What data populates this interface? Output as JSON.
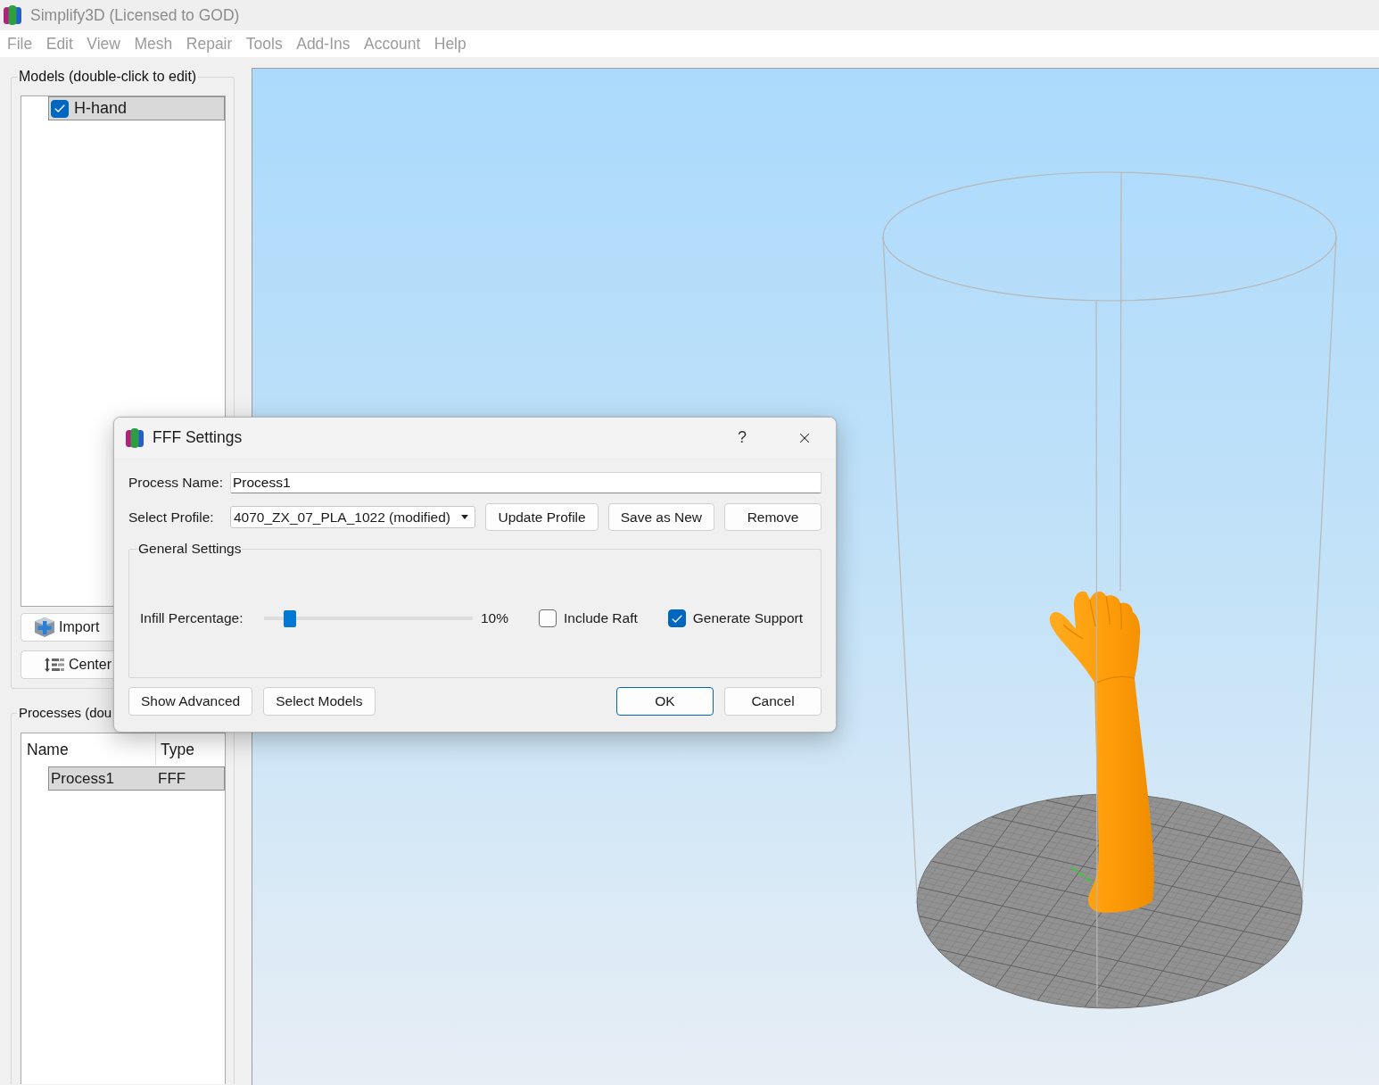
{
  "window": {
    "title": "Simplify3D (Licensed to GOD)"
  },
  "menu": [
    "File",
    "Edit",
    "View",
    "Mesh",
    "Repair",
    "Tools",
    "Add-Ins",
    "Account",
    "Help"
  ],
  "models_panel": {
    "title": "Models (double-click to edit)",
    "items": [
      {
        "name": "H-hand",
        "checked": true,
        "selected": true
      }
    ],
    "buttons": [
      {
        "label": "Import",
        "kind": "import"
      },
      {
        "label": "Center",
        "kind": "center"
      }
    ]
  },
  "processes_panel": {
    "title": "Processes (dou",
    "columns": [
      "Name",
      "Type"
    ],
    "rows": [
      {
        "name": "Process1",
        "type": "FFF",
        "selected": true
      }
    ]
  },
  "dialog": {
    "title": "FFF Settings",
    "help": "?",
    "process_name": {
      "label": "Process Name:",
      "value": "Process1"
    },
    "profile": {
      "label": "Select Profile:",
      "value": "4070_ZX_07_PLA_1022 (modified)",
      "buttons": [
        "Update Profile",
        "Save as New",
        "Remove"
      ]
    },
    "general_settings": {
      "title": "General Settings",
      "infill": {
        "label": "Infill Percentage:",
        "level": 0.1,
        "reading": "10%"
      },
      "options": [
        {
          "label": "Include Raft",
          "checked": false
        },
        {
          "label": "Generate Support",
          "checked": true
        }
      ]
    },
    "footer_buttons": [
      {
        "label": "Show Advanced",
        "primary": false
      },
      {
        "label": "Select Models",
        "primary": false
      }
    ],
    "dialog_buttons": [
      {
        "label": "OK",
        "primary": true
      },
      {
        "label": "Cancel",
        "primary": false
      }
    ]
  }
}
